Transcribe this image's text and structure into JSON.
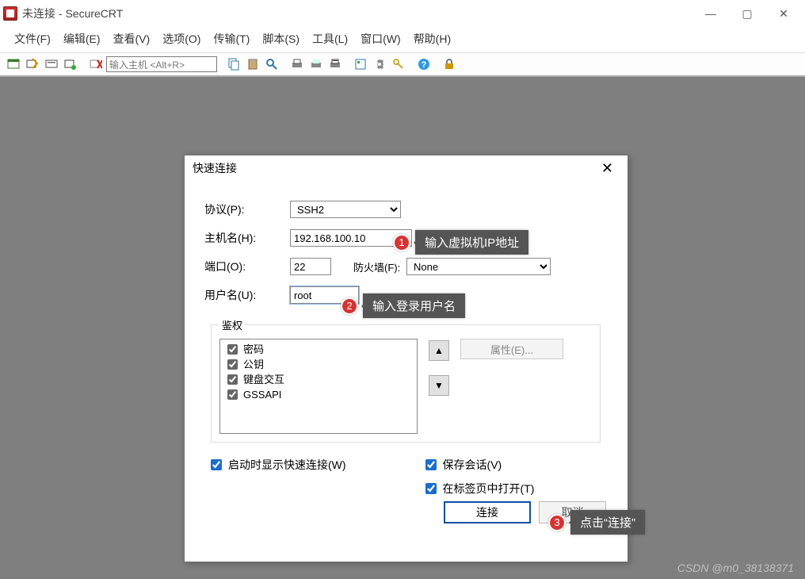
{
  "window": {
    "title": "未连接 - SecureCRT"
  },
  "menus": [
    "文件(F)",
    "编辑(E)",
    "查看(V)",
    "选项(O)",
    "传输(T)",
    "脚本(S)",
    "工具(L)",
    "窗口(W)",
    "帮助(H)"
  ],
  "toolbar": {
    "search_placeholder": "输入主机 <Alt+R>"
  },
  "dialog": {
    "title": "快速连接",
    "labels": {
      "protocol": "协议(P):",
      "hostname": "主机名(H):",
      "port": "端口(O):",
      "firewall": "防火墙(F):",
      "username": "用户名(U):",
      "auth_legend": "鉴权",
      "properties_btn": "属性(E)..."
    },
    "values": {
      "protocol": "SSH2",
      "hostname": "192.168.100.10",
      "port": "22",
      "firewall": "None",
      "username": "root"
    },
    "auth_methods": [
      "密码",
      "公钥",
      "键盘交互",
      "GSSAPI"
    ],
    "checkboxes": {
      "show_on_startup": "启动时显示快速连接(W)",
      "save_session": "保存会话(V)",
      "open_in_tab": "在标签页中打开(T)"
    },
    "buttons": {
      "connect": "连接",
      "cancel": "取消"
    }
  },
  "annotations": {
    "c1": {
      "num": "1",
      "text": "输入虚拟机IP地址"
    },
    "c2": {
      "num": "2",
      "text": "输入登录用户名"
    },
    "c3": {
      "num": "3",
      "text": "点击“连接”"
    }
  },
  "watermark": "CSDN @m0_38138371"
}
